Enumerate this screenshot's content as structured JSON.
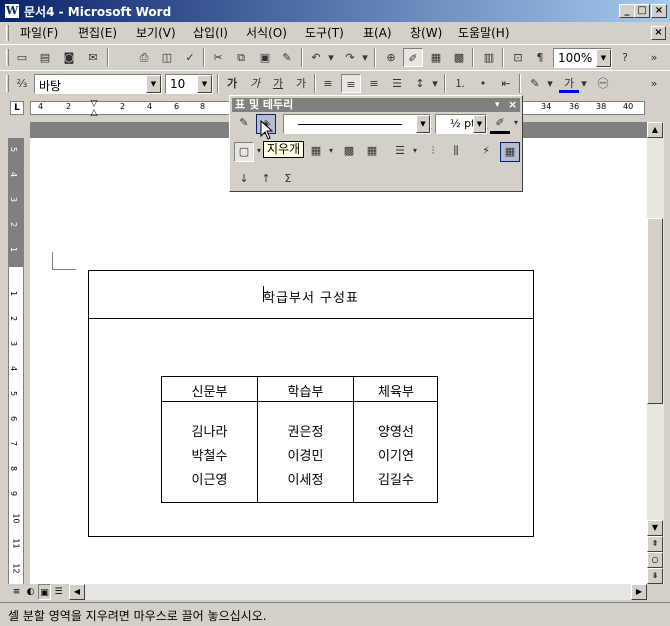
{
  "window": {
    "title": "문서4 - Microsoft Word",
    "icon_glyph": "W"
  },
  "menu": [
    "파일(F)",
    "편집(E)",
    "보기(V)",
    "삽입(I)",
    "서식(O)",
    "도구(T)",
    "표(A)",
    "창(W)",
    "도움말(H)"
  ],
  "toolbar_standard": {
    "zoom": "100%"
  },
  "toolbar_format": {
    "font": "바탕",
    "size": "10",
    "bold": "가",
    "italic": "가",
    "underline": "가",
    "strike": "가",
    "font_color_glyph": "가"
  },
  "ruler": {
    "corner": "L",
    "ticks": [
      "4",
      "2",
      "2",
      "4",
      "6",
      "8",
      "34",
      "36",
      "38",
      "40"
    ],
    "vticks": [
      "5",
      "4",
      "3",
      "2",
      "1",
      "1",
      "2",
      "3",
      "4",
      "5",
      "6",
      "7",
      "8",
      "9",
      "10",
      "11",
      "12"
    ]
  },
  "tables_toolbar": {
    "title": "표 및 테두리",
    "weight": "½ pt",
    "tooltip": "지우개",
    "sum_glyph": "Σ"
  },
  "document": {
    "title": "학급부서 구성표",
    "columns": [
      {
        "header": "신문부",
        "names": [
          "김나라",
          "박철수",
          "이근영"
        ]
      },
      {
        "header": "학습부",
        "names": [
          "권은정",
          "이경민",
          "이세정"
        ]
      },
      {
        "header": "체육부",
        "names": [
          "양영선",
          "이기연",
          "김길수"
        ]
      }
    ]
  },
  "statusbar": {
    "text": "셀 분할 영역을 지우려면 마우스로 끌어 놓으십시오."
  }
}
